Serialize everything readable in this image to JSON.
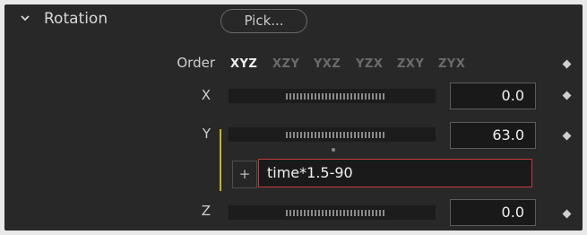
{
  "section": {
    "title": "Rotation",
    "pick_label": "Pick..."
  },
  "order": {
    "label": "Order",
    "options": [
      "XYZ",
      "XZY",
      "YXZ",
      "YZX",
      "ZXY",
      "ZYX"
    ],
    "selected": "XYZ"
  },
  "x": {
    "label": "X",
    "value": "0.0"
  },
  "y": {
    "label": "Y",
    "value": "63.0",
    "expression": "time*1.5-90",
    "expression_add_label": "+"
  },
  "z": {
    "label": "Z",
    "value": "0.0"
  },
  "colors": {
    "panel": "#282828",
    "expression_border": "#c43a3a",
    "expression_marker": "#c7b22c"
  }
}
